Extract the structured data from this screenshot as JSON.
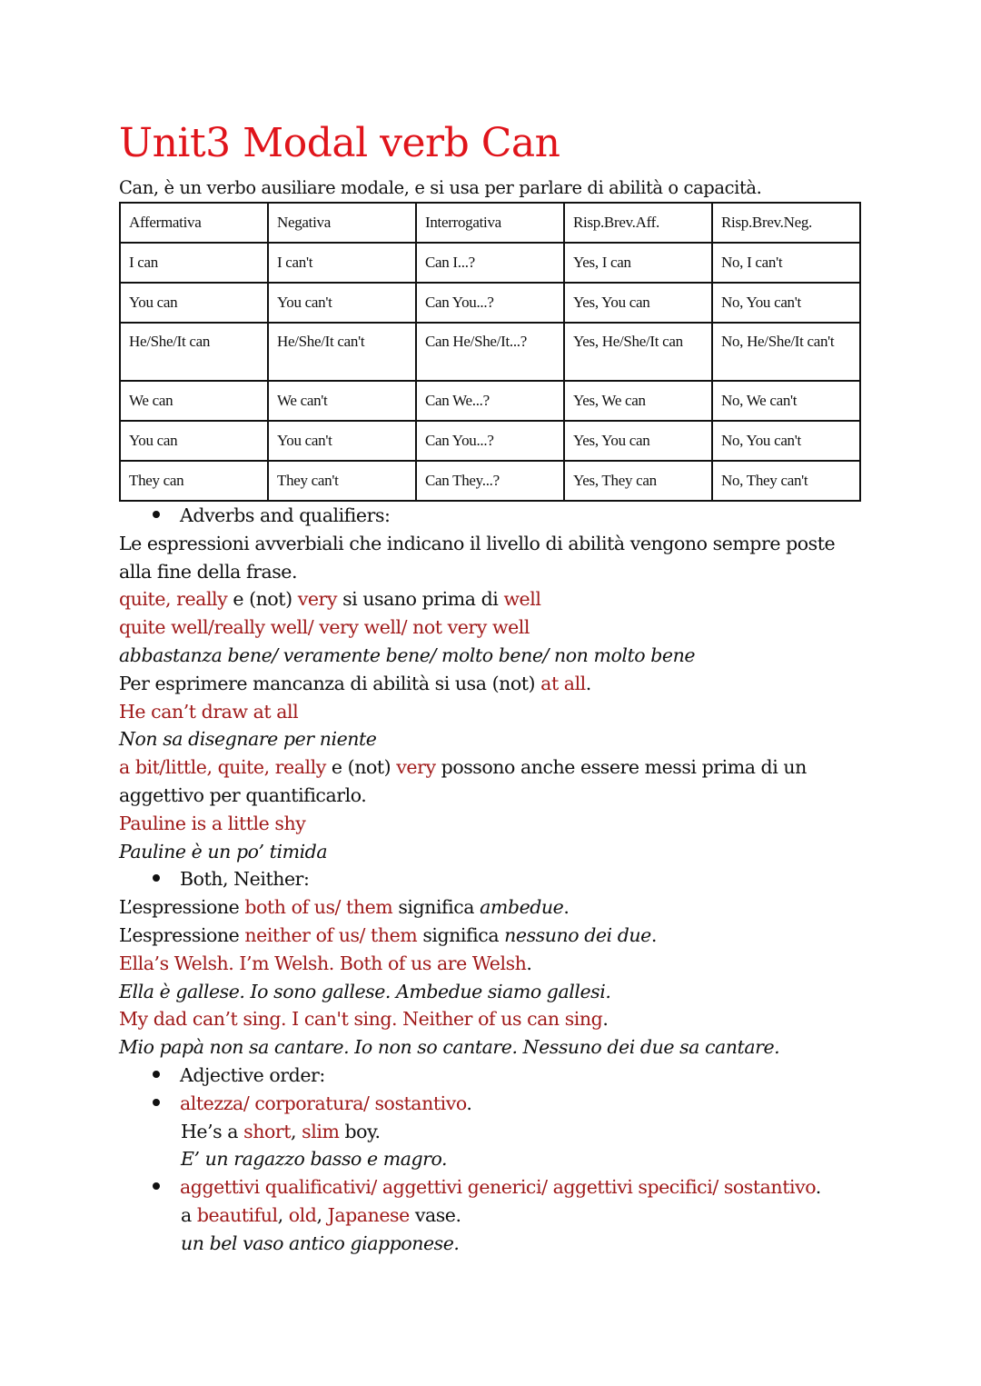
{
  "title": "Unit3 Modal verb Can",
  "intro": "Can, è un verbo ausiliare modale, e si usa per parlare di abilità o capacità.",
  "table": {
    "headers": [
      "Affermativa",
      "Negativa",
      "Interrogativa",
      "Risp.Brev.Aff.",
      "Risp.Brev.Neg."
    ],
    "rows": [
      [
        "I can",
        "I can't",
        "Can I...?",
        "Yes, I can",
        "No, I can't"
      ],
      [
        "You can",
        "You can't",
        "Can You...?",
        "Yes, You can",
        "No, You can't"
      ],
      [
        "He/She/It can",
        "He/She/It can't",
        "Can He/She/It...?",
        "Yes, He/She/It can",
        "No, He/She/It can't"
      ],
      [
        "We can",
        "We can't",
        "Can We...?",
        "Yes, We can",
        "No, We can't"
      ],
      [
        "You can",
        "You can't",
        "Can You...?",
        "Yes, You can",
        "No, You can't"
      ],
      [
        "They can",
        "They can't",
        "Can They...?",
        "Yes, They can",
        "No, They can't"
      ]
    ]
  },
  "adverbs": {
    "heading": "Adverbs and qualifiers:",
    "p1": "Le espressioni avverbiali che indicano il livello di abilità vengono sempre poste alla fine della frase.",
    "l1": {
      "a": "quite, really",
      "b": " e (not) ",
      "c": "very",
      "d": " si usano prima di ",
      "e": "well"
    },
    "l2": "quite well/really well/ very well/ not very well",
    "l3": "abbastanza bene/ veramente bene/ molto bene/ non molto bene",
    "l4": {
      "a": "Per esprimere mancanza di abilità si usa (not) ",
      "b": "at all",
      "c": "."
    },
    "l5": "He can’t draw at all",
    "l6": "Non sa disegnare per niente",
    "l7": {
      "a": "a bit/little, quite, really",
      "b": " e (not) ",
      "c": "very",
      "d": " possono anche essere messi prima di un aggettivo per quantificarlo."
    },
    "l8": "Pauline is a little shy",
    "l9": "Pauline è un po’ timida"
  },
  "both": {
    "heading": "Both, Neither:",
    "l1": {
      "a": "L’espressione ",
      "b": "both of us/ them",
      "c": " significa ",
      "d": "ambedue",
      "e": "."
    },
    "l2": {
      "a": "L’espressione ",
      "b": "neither of us/ them",
      "c": " significa ",
      "d": "nessuno dei due",
      "e": "."
    },
    "l3": {
      "a": "Ella’s Welsh. I’m Welsh. Both of us are Welsh",
      "b": "."
    },
    "l4": "Ella è gallese. Io sono gallese. Ambedue siamo gallesi.",
    "l5": {
      "a": "My dad can’t sing. I can't sing. Neither of us can sing",
      "b": "."
    },
    "l6": "Mio papà non sa cantare. Io non so cantare. Nessuno dei due sa cantare."
  },
  "adjective": {
    "heading": "Adjective order:",
    "rule1": {
      "a": "altezza/ corporatura/ sostantivo",
      "b": "."
    },
    "ex1": {
      "a": "He’s a ",
      "b": "short",
      "c": ", ",
      "d": "slim",
      "e": " boy."
    },
    "tr1": "E’ un ragazzo basso e magro.",
    "rule2": {
      "a": "aggettivi qualificativi/ aggettivi generici/ aggettivi specifici/ sostantivo",
      "b": "."
    },
    "ex2": {
      "a": "a ",
      "b": "beautiful",
      "c": ", ",
      "d": "old",
      "e": ", ",
      "f": "Japanese",
      "g": " vase."
    },
    "tr2": "un bel vaso antico giapponese."
  },
  "colors": {
    "title": "#e0141b",
    "highlight": "#a01a1a",
    "text": "#111111"
  }
}
